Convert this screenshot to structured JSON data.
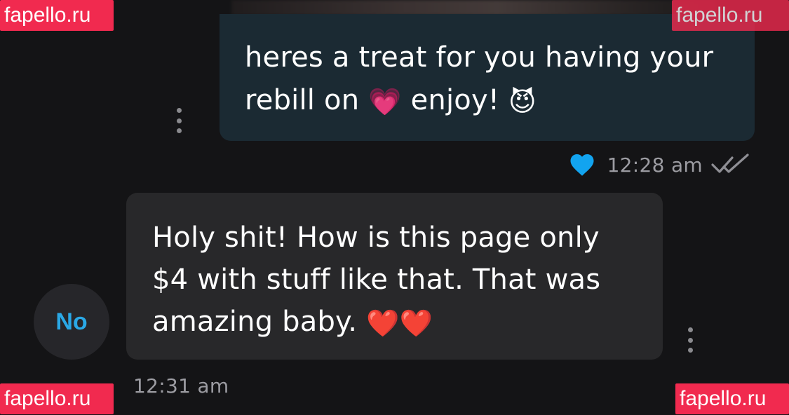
{
  "watermark": {
    "text": "fapello.ru"
  },
  "outgoing_message": {
    "text_line1": "heres a treat for you having your",
    "text_line2_before": "rebill on",
    "emoji_1": "💗",
    "text_line2_mid": "enjoy!",
    "emoji_2": "😈",
    "time": "12:28 am",
    "liked": true,
    "read_status": "double-check"
  },
  "incoming_message": {
    "text_line1": "Holy shit! How is this page only",
    "text_line2": "$4 with stuff like that. That was",
    "text_line3": "amazing baby.",
    "emoji": "❤️❤️",
    "time": "12:31 am"
  },
  "sender_avatar": {
    "initials": "No"
  },
  "colors": {
    "background": "#141416",
    "outgoing_bubble": "#1b2a33",
    "incoming_bubble": "#28282a",
    "accent_blue": "#12a4f0",
    "watermark_red": "#f12a4f",
    "muted_text": "#9c9ca2"
  },
  "icons": {
    "like": "heart-icon",
    "read_receipt": "double-check-icon",
    "more_options": "more-vertical-icon"
  }
}
